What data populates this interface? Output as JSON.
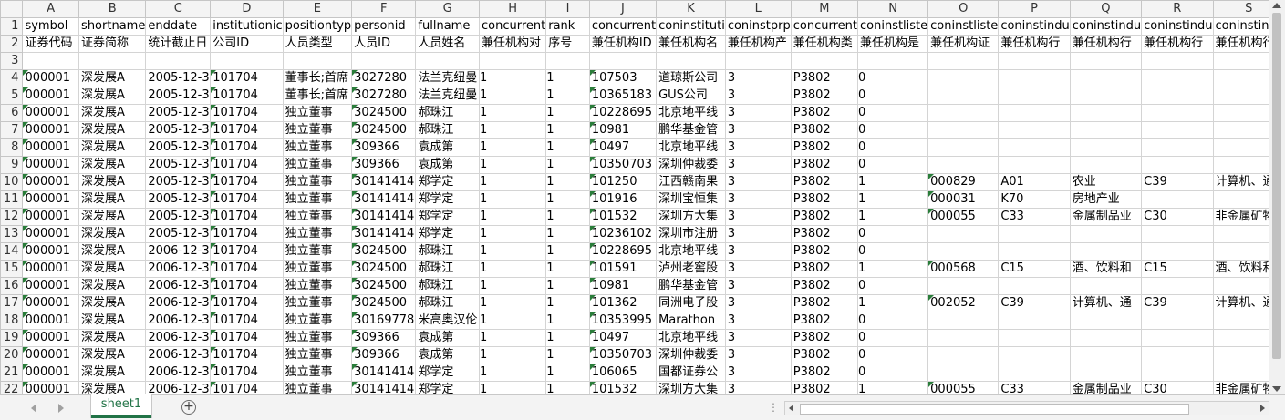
{
  "columns": [
    "A",
    "B",
    "C",
    "D",
    "E",
    "F",
    "G",
    "H",
    "I",
    "J",
    "K",
    "L",
    "M",
    "N",
    "O",
    "P",
    "Q",
    "R",
    "S"
  ],
  "rows": [
    {
      "n": "1",
      "c": [
        "symbol",
        "shortname",
        "enddate",
        "institutionic",
        "positiontyp",
        "personid",
        "fullname",
        "concurrent",
        "rank",
        "concurrent",
        "coninstituti",
        "coninstprp",
        "concurrent",
        "coninstliste",
        "coninstliste",
        "coninstindu",
        "coninstindu",
        "coninstindu",
        "coninstindu"
      ]
    },
    {
      "n": "2",
      "c": [
        "证券代码",
        "证券简称",
        "统计截止日",
        "公司ID",
        "人员类型",
        "人员ID",
        "人员姓名",
        "兼任机构对",
        "序号",
        "兼任机构ID",
        "兼任机构名",
        "兼任机构产",
        "兼任机构类",
        "兼任机构是",
        "兼任机构证",
        "兼任机构行",
        "兼任机构行",
        "兼任机构行",
        "兼任机构行"
      ]
    },
    {
      "n": "3",
      "c": [
        "",
        "",
        "",
        "",
        "",
        "",
        "",
        "",
        "",
        "",
        "",
        "",
        "",
        "",
        "",
        "",
        "",
        "",
        ""
      ]
    },
    {
      "n": "4",
      "c": [
        "000001",
        "深发展A",
        "2005-12-3",
        "101704",
        "董事长;首席",
        "3027280",
        "法兰克纽曼",
        "1",
        "1",
        "107503",
        "道琼斯公司",
        "3",
        "P3802",
        "0",
        "",
        "",
        "",
        "",
        ""
      ]
    },
    {
      "n": "5",
      "c": [
        "000001",
        "深发展A",
        "2005-12-3",
        "101704",
        "董事长;首席",
        "3027280",
        "法兰克纽曼",
        "1",
        "1",
        "10365183",
        "GUS公司",
        "3",
        "P3802",
        "0",
        "",
        "",
        "",
        "",
        ""
      ]
    },
    {
      "n": "6",
      "c": [
        "000001",
        "深发展A",
        "2005-12-3",
        "101704",
        "独立董事",
        "3024500",
        "郝珠江",
        "1",
        "1",
        "10228695",
        "北京地平线",
        "3",
        "P3802",
        "0",
        "",
        "",
        "",
        "",
        ""
      ]
    },
    {
      "n": "7",
      "c": [
        "000001",
        "深发展A",
        "2005-12-3",
        "101704",
        "独立董事",
        "3024500",
        "郝珠江",
        "1",
        "1",
        "10981",
        "鹏华基金管",
        "3",
        "P3802",
        "0",
        "",
        "",
        "",
        "",
        ""
      ]
    },
    {
      "n": "8",
      "c": [
        "000001",
        "深发展A",
        "2005-12-3",
        "101704",
        "独立董事",
        "309366",
        "袁成第",
        "1",
        "1",
        "10497",
        "北京地平线",
        "3",
        "P3802",
        "0",
        "",
        "",
        "",
        "",
        ""
      ]
    },
    {
      "n": "9",
      "c": [
        "000001",
        "深发展A",
        "2005-12-3",
        "101704",
        "独立董事",
        "309366",
        "袁成第",
        "1",
        "1",
        "10350703",
        "深圳仲裁委",
        "3",
        "P3802",
        "0",
        "",
        "",
        "",
        "",
        ""
      ]
    },
    {
      "n": "10",
      "c": [
        "000001",
        "深发展A",
        "2005-12-3",
        "101704",
        "独立董事",
        "30141414",
        "郑学定",
        "1",
        "1",
        "101250",
        "江西赣南果",
        "3",
        "P3802",
        "1",
        "000829",
        "A01",
        "农业",
        "C39",
        "计算机、通"
      ]
    },
    {
      "n": "11",
      "c": [
        "000001",
        "深发展A",
        "2005-12-3",
        "101704",
        "独立董事",
        "30141414",
        "郑学定",
        "1",
        "1",
        "101916",
        "深圳宝恒集",
        "3",
        "P3802",
        "1",
        "000031",
        "K70",
        "房地产业",
        "",
        ""
      ]
    },
    {
      "n": "12",
      "c": [
        "000001",
        "深发展A",
        "2005-12-3",
        "101704",
        "独立董事",
        "30141414",
        "郑学定",
        "1",
        "1",
        "101532",
        "深圳方大集",
        "3",
        "P3802",
        "1",
        "000055",
        "C33",
        "金属制品业",
        "C30",
        "非金属矿物"
      ]
    },
    {
      "n": "13",
      "c": [
        "000001",
        "深发展A",
        "2005-12-3",
        "101704",
        "独立董事",
        "30141414",
        "郑学定",
        "1",
        "1",
        "10236102",
        "深圳市注册",
        "3",
        "P3802",
        "0",
        "",
        "",
        "",
        "",
        ""
      ]
    },
    {
      "n": "14",
      "c": [
        "000001",
        "深发展A",
        "2006-12-3",
        "101704",
        "独立董事",
        "3024500",
        "郝珠江",
        "1",
        "1",
        "10228695",
        "北京地平线",
        "3",
        "P3802",
        "0",
        "",
        "",
        "",
        "",
        ""
      ]
    },
    {
      "n": "15",
      "c": [
        "000001",
        "深发展A",
        "2006-12-3",
        "101704",
        "独立董事",
        "3024500",
        "郝珠江",
        "1",
        "1",
        "101591",
        "泸州老窖股",
        "3",
        "P3802",
        "1",
        "000568",
        "C15",
        "酒、饮料和",
        "C15",
        "酒、饮料和"
      ]
    },
    {
      "n": "16",
      "c": [
        "000001",
        "深发展A",
        "2006-12-3",
        "101704",
        "独立董事",
        "3024500",
        "郝珠江",
        "1",
        "1",
        "10981",
        "鹏华基金管",
        "3",
        "P3802",
        "0",
        "",
        "",
        "",
        "",
        ""
      ]
    },
    {
      "n": "17",
      "c": [
        "000001",
        "深发展A",
        "2006-12-3",
        "101704",
        "独立董事",
        "3024500",
        "郝珠江",
        "1",
        "1",
        "101362",
        "同洲电子股",
        "3",
        "P3802",
        "1",
        "002052",
        "C39",
        "计算机、通",
        "C39",
        "计算机、通"
      ]
    },
    {
      "n": "18",
      "c": [
        "000001",
        "深发展A",
        "2006-12-3",
        "101704",
        "独立董事",
        "30169778",
        "米高奥汉伦",
        "1",
        "1",
        "10353995",
        "Marathon",
        "3",
        "P3802",
        "0",
        "",
        "",
        "",
        "",
        ""
      ]
    },
    {
      "n": "19",
      "c": [
        "000001",
        "深发展A",
        "2006-12-3",
        "101704",
        "独立董事",
        "309366",
        "袁成第",
        "1",
        "1",
        "10497",
        "北京地平线",
        "3",
        "P3802",
        "0",
        "",
        "",
        "",
        "",
        ""
      ]
    },
    {
      "n": "20",
      "c": [
        "000001",
        "深发展A",
        "2006-12-3",
        "101704",
        "独立董事",
        "309366",
        "袁成第",
        "1",
        "1",
        "10350703",
        "深圳仲裁委",
        "3",
        "P3802",
        "0",
        "",
        "",
        "",
        "",
        ""
      ]
    },
    {
      "n": "21",
      "c": [
        "000001",
        "深发展A",
        "2006-12-3",
        "101704",
        "独立董事",
        "30141414",
        "郑学定",
        "1",
        "1",
        "106065",
        "国都证券公",
        "3",
        "P3802",
        "0",
        "",
        "",
        "",
        "",
        ""
      ]
    },
    {
      "n": "22",
      "c": [
        "000001",
        "深发展A",
        "2006-12-3",
        "101704",
        "独立董事",
        "30141414",
        "郑学定",
        "1",
        "1",
        "101532",
        "深圳方大集",
        "3",
        "P3802",
        "1",
        "000055",
        "C33",
        "金属制品业",
        "C30",
        "非金属矿物"
      ]
    }
  ],
  "sheet_tab": "sheet1",
  "add_sheet_symbol": "+",
  "accent_color": "#217346"
}
